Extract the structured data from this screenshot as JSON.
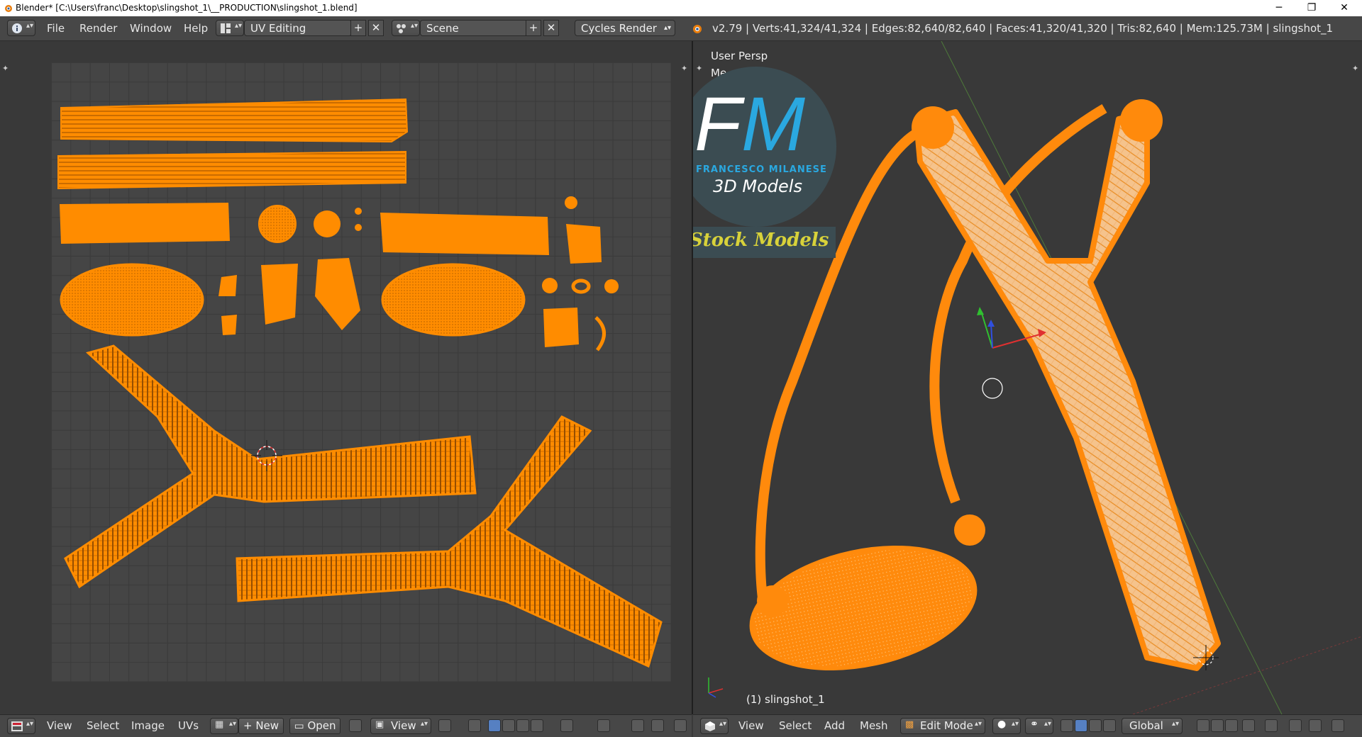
{
  "window": {
    "title": "Blender* [C:\\Users\\franc\\Desktop\\slingshot_1\\__PRODUCTION\\slingshot_1.blend]",
    "minimize": "─",
    "restore": "❐",
    "close": "✕"
  },
  "infobar": {
    "menus": [
      "File",
      "Render",
      "Window",
      "Help"
    ],
    "screen_layout": "UV Editing",
    "scene": "Scene",
    "render_engine": "Cycles Render",
    "stats": "v2.79 | Verts:41,324/41,324 | Edges:82,640/82,640 | Faces:41,320/41,320 | Tris:82,640 | Mem:125.73M | slingshot_1"
  },
  "viewport": {
    "view_label": "User Persp",
    "overlay_partial": "Me",
    "object_label": "(1) slingshot_1",
    "watermark": {
      "initials_f": "F",
      "initials_m": "M",
      "brand": "FRANCESCO MILANESE",
      "sub": "3D Models",
      "tag": "Stock Models"
    }
  },
  "uv_footer": {
    "menus": [
      "View",
      "Select",
      "Image",
      "UVs"
    ],
    "new_label": "New",
    "open_label": "Open",
    "view_label": "View"
  },
  "vp_footer": {
    "menus": [
      "View",
      "Select",
      "Add",
      "Mesh"
    ],
    "mode": "Edit Mode",
    "orientation": "Global"
  },
  "colors": {
    "uv_orange": "#ff8c00",
    "mesh_orange": "#ff8a0c",
    "header_bg": "#474747",
    "editor_bg": "#393939"
  }
}
